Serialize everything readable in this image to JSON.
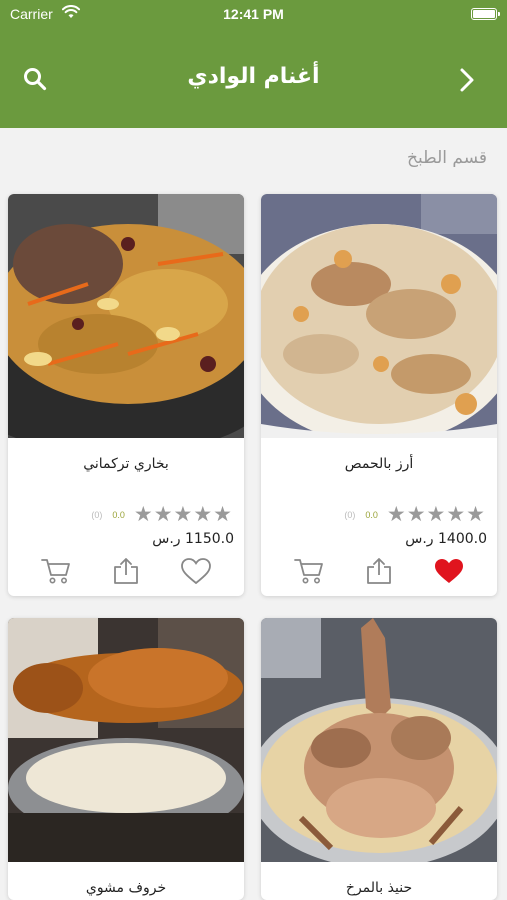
{
  "status": {
    "carrier": "Carrier",
    "time": "12:41 PM"
  },
  "header": {
    "title": "أغنام الوادي"
  },
  "section": {
    "title": "قسم الطبخ"
  },
  "colors": {
    "brand_green": "#6b9a3e",
    "favorite_red": "#e0141e",
    "rating_value": "#9ba43a"
  },
  "products": [
    {
      "name": "أرز بالحمص",
      "rating_avg": "0.0",
      "rating_count": "(0)",
      "price": "1400.0 ر.س",
      "favorited": true
    },
    {
      "name": "بخاري تركماني",
      "rating_avg": "0.0",
      "rating_count": "(0)",
      "price": "1150.0 ر.س",
      "favorited": false
    },
    {
      "name": "حنيذ بالمرخ"
    },
    {
      "name": "خروف مشوي"
    }
  ]
}
